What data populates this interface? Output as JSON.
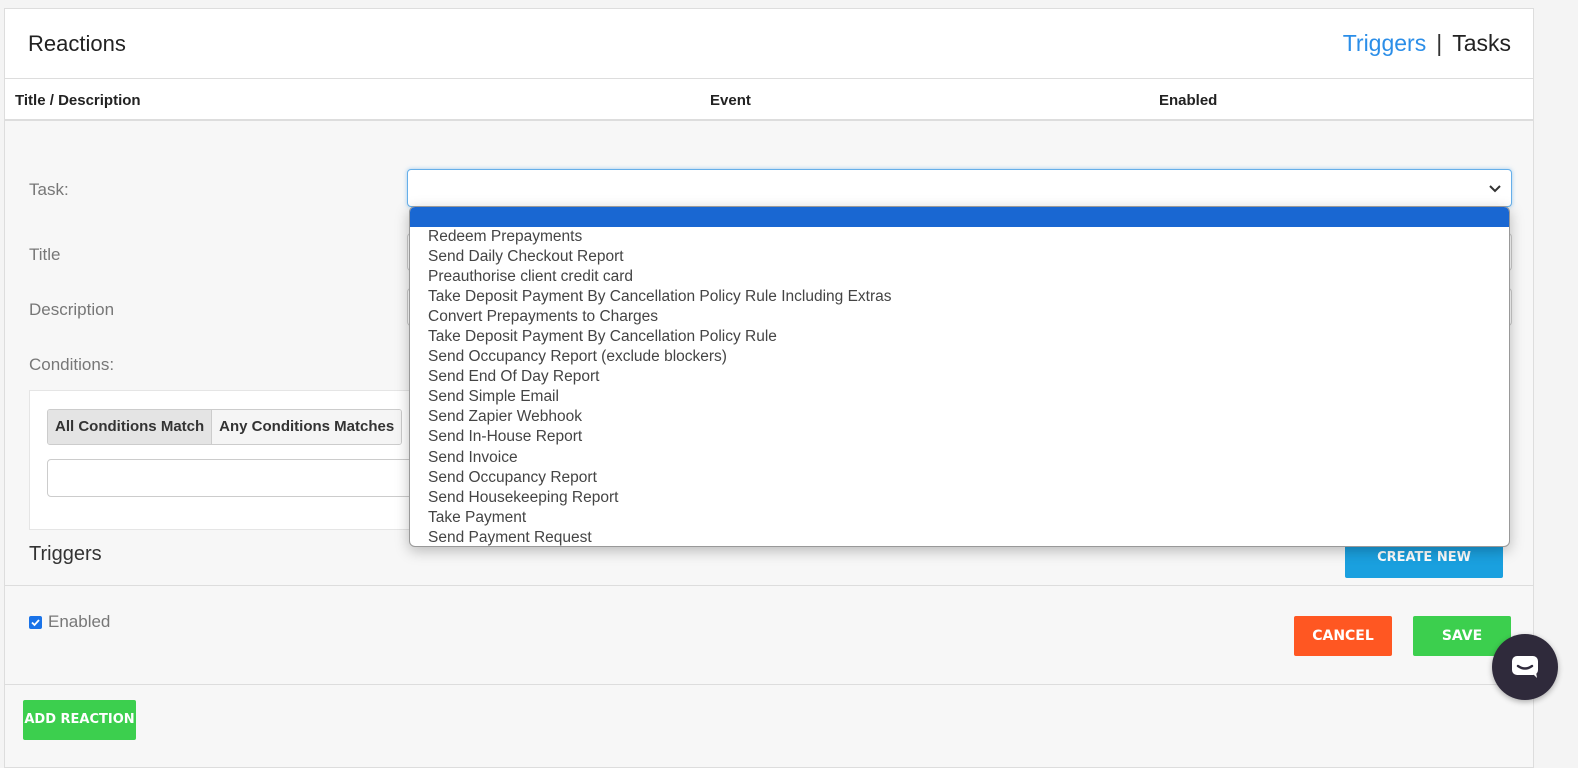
{
  "header": {
    "title": "Reactions",
    "link_triggers": "Triggers",
    "separator": "|",
    "link_tasks": "Tasks"
  },
  "table": {
    "columns": [
      "Title / Description",
      "Event",
      "Enabled"
    ]
  },
  "form": {
    "task_label": "Task:",
    "task_value": "",
    "title_label": "Title",
    "description_label": "Description",
    "conditions_label": "Conditions:",
    "match_all_label": "All Conditions Match",
    "match_any_label": "Any Conditions Matches",
    "triggers_label": "Triggers",
    "create_trigger_label": "CREATE NEW TRIGGER",
    "enabled_label": "Enabled",
    "enabled_checked": true,
    "cancel_label": "CANCEL",
    "save_label": "SAVE",
    "add_reaction_label": "ADD REACTION"
  },
  "dropdown": {
    "options": [
      "Redeem Prepayments",
      "Send Daily Checkout Report",
      "Preauthorise client credit card",
      "Take Deposit Payment By Cancellation Policy Rule Including Extras",
      "Convert Prepayments to Charges",
      "Take Deposit Payment By Cancellation Policy Rule",
      "Send Occupancy Report (exclude blockers)",
      "Send End Of Day Report",
      "Send Simple Email",
      "Send Zapier Webhook",
      "Send In-House Report",
      "Send Invoice",
      "Send Occupancy Report",
      "Send Housekeeping Report",
      "Take Payment",
      "Send Payment Request"
    ]
  },
  "colors": {
    "link_blue": "#2b8ee8",
    "highlight_blue": "#1967d2",
    "cancel_orange": "#ff5722",
    "save_green": "#3ccf4e",
    "create_blue": "#1aa0df",
    "chat_dark": "#2f2a3b"
  },
  "icons": {
    "select_chevron": "chevron-down-icon",
    "checkbox": "check-icon",
    "chat": "chat-icon"
  }
}
